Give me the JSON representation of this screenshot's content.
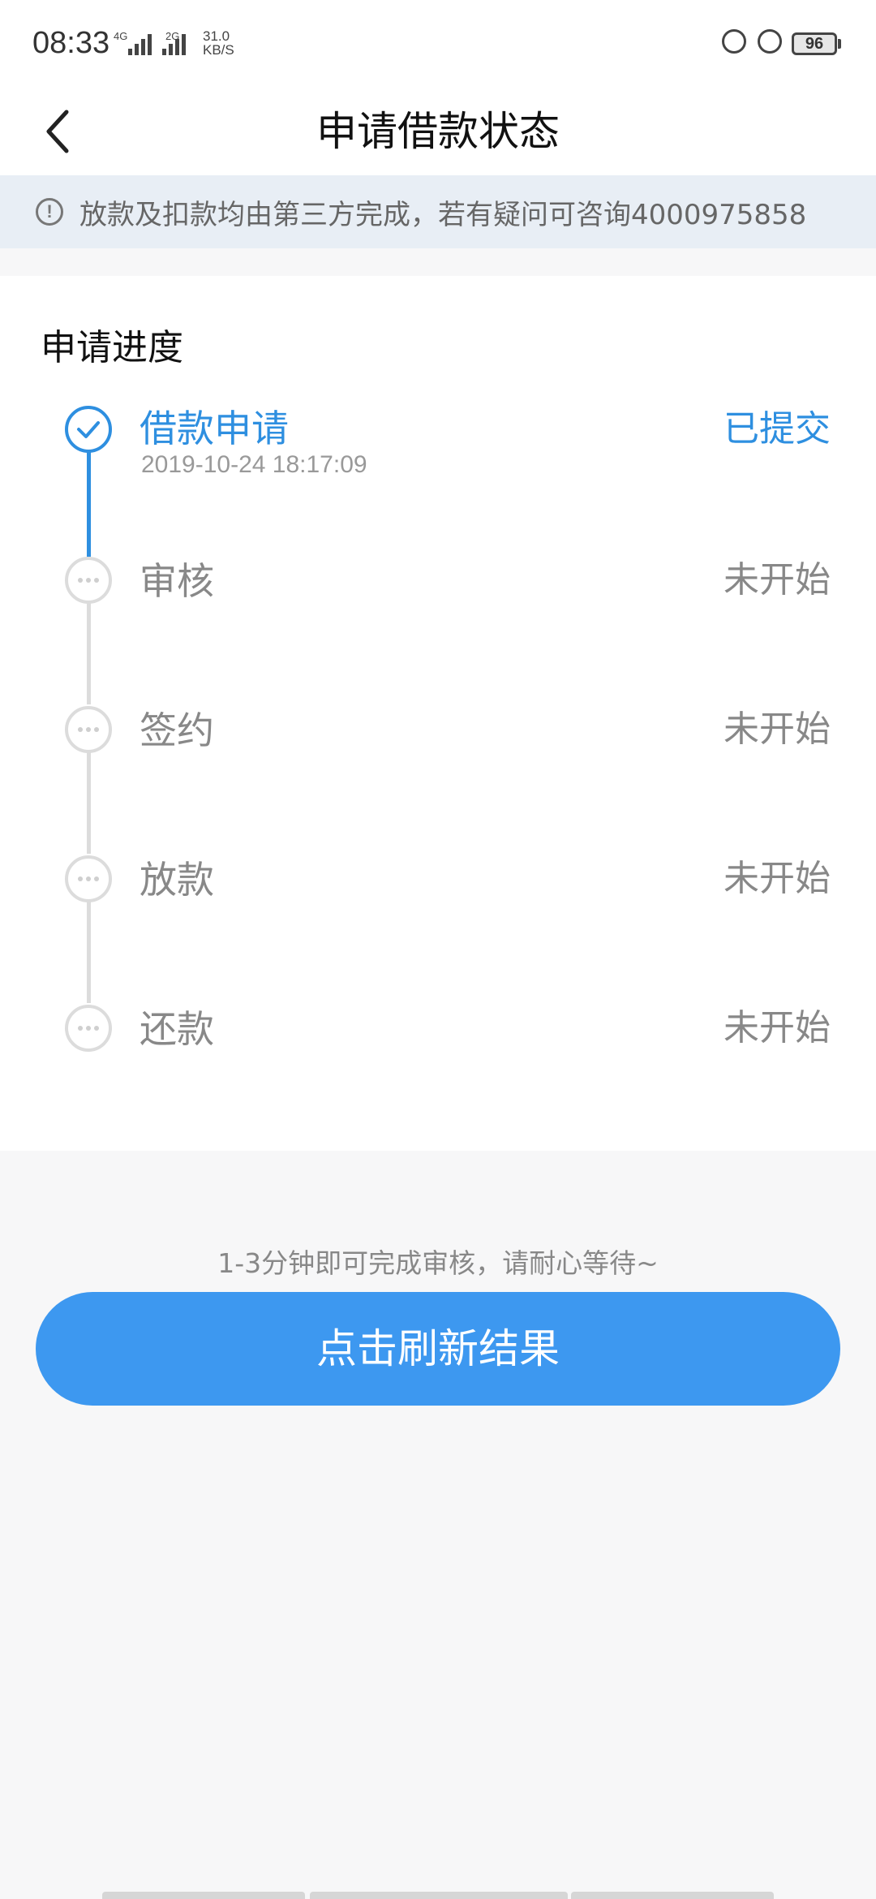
{
  "status_bar": {
    "time": "08:33",
    "net1": "4G",
    "net2": "2G",
    "speed_value": "31.0",
    "speed_unit": "KB/S",
    "battery": "96"
  },
  "header": {
    "title": "申请借款状态"
  },
  "notice": {
    "text": "放款及扣款均由第三方完成，若有疑问可咨询4000975858"
  },
  "progress": {
    "section_title": "申请进度",
    "steps": [
      {
        "name": "借款申请",
        "time": "2019-10-24 18:17:09",
        "status": "已提交",
        "state": "done"
      },
      {
        "name": "审核",
        "time": "",
        "status": "未开始",
        "state": "pending"
      },
      {
        "name": "签约",
        "time": "",
        "status": "未开始",
        "state": "pending"
      },
      {
        "name": "放款",
        "time": "",
        "status": "未开始",
        "state": "pending"
      },
      {
        "name": "还款",
        "time": "",
        "status": "未开始",
        "state": "pending"
      }
    ]
  },
  "footer": {
    "hint": "1-3分钟即可完成审核，请耐心等待~",
    "button_label": "点击刷新结果"
  },
  "colors": {
    "accent": "#2e8fe0",
    "button": "#3d98f0",
    "notice_bg": "#e8eef5"
  }
}
